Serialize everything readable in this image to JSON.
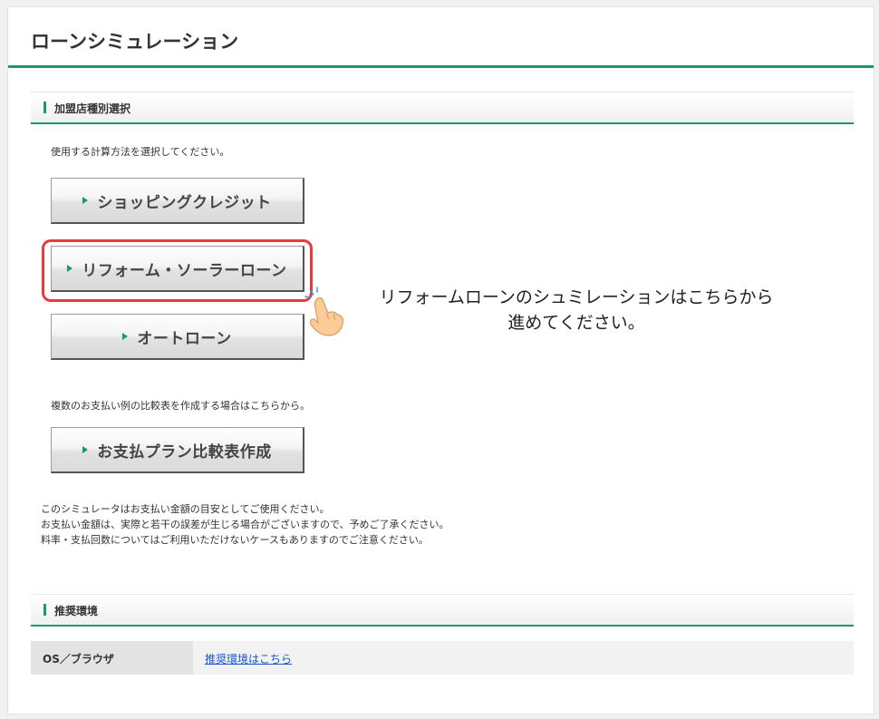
{
  "page": {
    "title": "ローンシミュレーション"
  },
  "merchant_section": {
    "heading": "加盟店種別選択",
    "instruction": "使用する計算方法を選択してください。",
    "buttons": [
      {
        "label": "ショッピングクレジット"
      },
      {
        "label": "リフォーム・ソーラーローン"
      },
      {
        "label": "オートローン"
      }
    ],
    "compare_intro": "複数のお支払い例の比較表を作成する場合はこちらから。",
    "compare_button": {
      "label": "お支払プラン比較表作成"
    },
    "notes": [
      "このシミュレータはお支払い金額の目安としてご使用ください。",
      "お支払い金額は、実際と若干の誤差が生じる場合がございますので、予めご了承ください。",
      "料率・支払回数についてはご利用いただけないケースもありますのでご注意ください。"
    ]
  },
  "callout": {
    "line1": "リフォームローンのシュミレーションはこちらから",
    "line2": "進めてください。"
  },
  "environment_section": {
    "heading": "推奨環境",
    "row": {
      "key": "OS／ブラウザ",
      "link": "推奨環境はこちら"
    }
  },
  "colors": {
    "accent": "#1a9a6a",
    "highlight": "#e83b3b",
    "link": "#1a55cc"
  }
}
